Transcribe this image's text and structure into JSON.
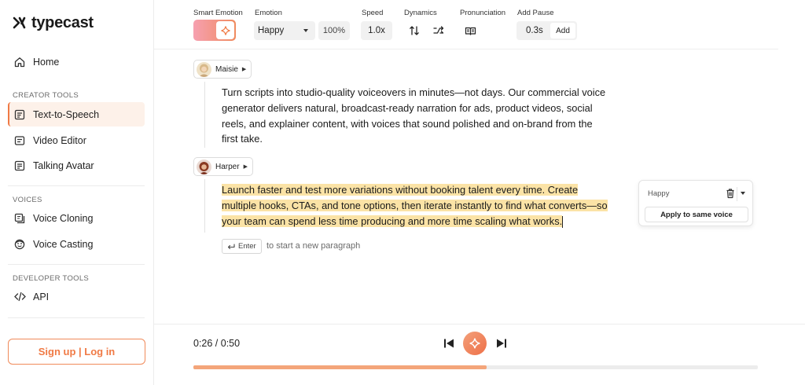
{
  "app": {
    "logo_text": "typecast"
  },
  "sidebar": {
    "home": "Home",
    "creator_tools_label": "CREATOR TOOLS",
    "creator_tools": [
      "Text-to-Speech",
      "Video Editor",
      "Talking Avatar"
    ],
    "voices_label": "VOICES",
    "voices": [
      "Voice Cloning",
      "Voice Casting"
    ],
    "developer_tools_label": "DEVELOPER TOOLS",
    "developer_tools": [
      "API"
    ],
    "active_item": "Text-to-Speech",
    "signup_label": "Sign up | Log in"
  },
  "toolbar": {
    "smart_emotion_label": "Smart Emotion",
    "emotion_label": "Emotion",
    "emotion_value": "Happy",
    "emotion_intensity": "100%",
    "speed_label": "Speed",
    "speed_value": "1.0x",
    "dynamics_label": "Dynamics",
    "pronunciation_label": "Pronunciation",
    "add_pause_label": "Add Pause",
    "pause_value": "0.3s",
    "add_button": "Add"
  },
  "editor": {
    "blocks": [
      {
        "speaker": "Maisie",
        "text": "Turn scripts into studio-quality voiceovers in minutes—not days. Our commercial voice generator delivers natural, broadcast-ready narration for ads, product videos, social reels, and explainer content, with voices that sound polished and on-brand from the first take.",
        "lines": [
          "Turn scripts into studio-quality voiceovers in minutes—not days. Our commercial voice",
          "generator delivers natural, broadcast-ready narration for ads, product videos, social",
          "reels, and explainer content, with voices that sound polished and on-brand from the",
          "first take."
        ]
      },
      {
        "speaker": "Harper",
        "text": "Launch faster and test more variations without booking talent every time. Create multiple hooks, CTAs, and tone options, then iterate instantly to find what converts—so your team can spend less time producing and more time scaling what works.",
        "lines": [
          "Launch faster and test more variations without booking talent every time. Create",
          "multiple hooks, CTAs, and tone options, then iterate instantly to find what converts—so",
          "your team can spend less time producing and more time scaling what works."
        ]
      }
    ],
    "enter_key": "Enter",
    "enter_hint": "to start a new paragraph"
  },
  "floating_panel": {
    "emotion": "Happy",
    "apply_button": "Apply to same voice"
  },
  "player": {
    "time": "0:26 / 0:50",
    "progress": 0.52
  },
  "colors": {
    "accent": "#f07a45",
    "highlight": "#fbe3a6",
    "active_bg": "#fdf1e9"
  }
}
